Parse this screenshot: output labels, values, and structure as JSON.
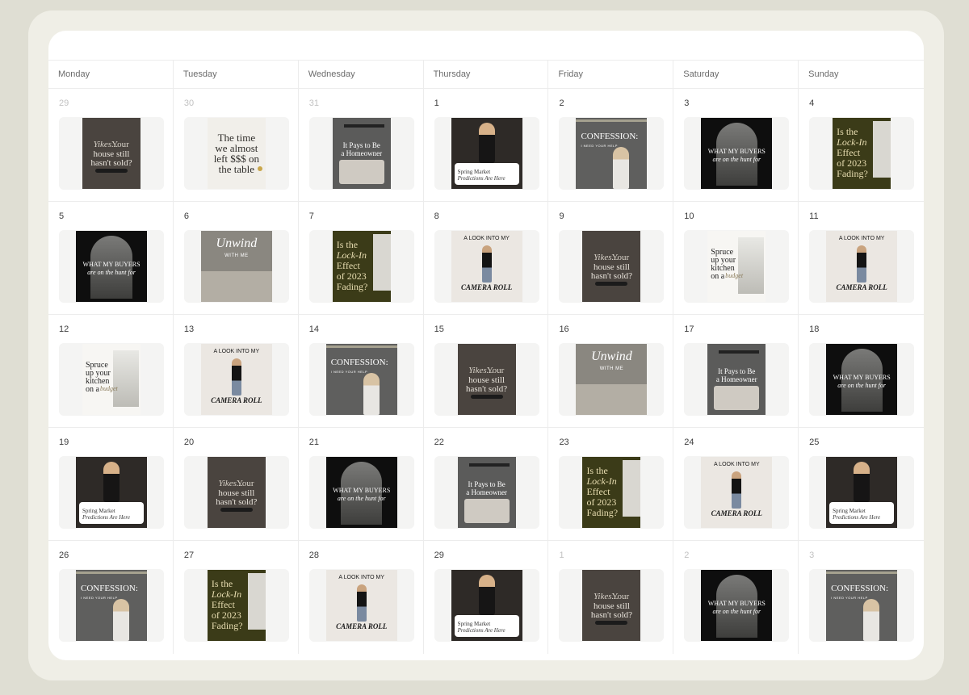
{
  "days": [
    "Monday",
    "Tuesday",
    "Wednesday",
    "Thursday",
    "Friday",
    "Saturday",
    "Sunday"
  ],
  "weeks": [
    [
      {
        "n": "29",
        "muted": true,
        "post": "yikes"
      },
      {
        "n": "30",
        "muted": true,
        "post": "time"
      },
      {
        "n": "31",
        "muted": true,
        "post": "pays"
      },
      {
        "n": "1",
        "muted": false,
        "post": "spring"
      },
      {
        "n": "2",
        "muted": false,
        "post": "confession"
      },
      {
        "n": "3",
        "muted": false,
        "post": "buyers"
      },
      {
        "n": "4",
        "muted": false,
        "post": "lockin"
      }
    ],
    [
      {
        "n": "5",
        "muted": false,
        "post": "buyers"
      },
      {
        "n": "6",
        "muted": false,
        "post": "unwind"
      },
      {
        "n": "7",
        "muted": false,
        "post": "lockin"
      },
      {
        "n": "8",
        "muted": false,
        "post": "camera"
      },
      {
        "n": "9",
        "muted": false,
        "post": "yikes"
      },
      {
        "n": "10",
        "muted": false,
        "post": "spruce"
      },
      {
        "n": "11",
        "muted": false,
        "post": "camera"
      }
    ],
    [
      {
        "n": "12",
        "muted": false,
        "post": "spruce"
      },
      {
        "n": "13",
        "muted": false,
        "post": "camera"
      },
      {
        "n": "14",
        "muted": false,
        "post": "confession"
      },
      {
        "n": "15",
        "muted": false,
        "post": "yikes"
      },
      {
        "n": "16",
        "muted": false,
        "post": "unwind"
      },
      {
        "n": "17",
        "muted": false,
        "post": "pays"
      },
      {
        "n": "18",
        "muted": false,
        "post": "buyers"
      }
    ],
    [
      {
        "n": "19",
        "muted": false,
        "post": "spring"
      },
      {
        "n": "20",
        "muted": false,
        "post": "yikes"
      },
      {
        "n": "21",
        "muted": false,
        "post": "buyers"
      },
      {
        "n": "22",
        "muted": false,
        "post": "pays"
      },
      {
        "n": "23",
        "muted": false,
        "post": "lockin"
      },
      {
        "n": "24",
        "muted": false,
        "post": "camera"
      },
      {
        "n": "25",
        "muted": false,
        "post": "spring"
      }
    ],
    [
      {
        "n": "26",
        "muted": false,
        "post": "confession"
      },
      {
        "n": "27",
        "muted": false,
        "post": "lockin"
      },
      {
        "n": "28",
        "muted": false,
        "post": "camera"
      },
      {
        "n": "29",
        "muted": false,
        "post": "spring"
      },
      {
        "n": "1",
        "muted": true,
        "post": "yikes"
      },
      {
        "n": "2",
        "muted": true,
        "post": "buyers"
      },
      {
        "n": "3",
        "muted": true,
        "post": "confession"
      }
    ]
  ],
  "posts": {
    "yikes": {
      "l1": "Yikes...",
      "l2": "Your",
      "l3": "house still",
      "l4": "hasn't sold?",
      "bg": "#4a443f"
    },
    "time": {
      "l1": "The time",
      "l2": "we almost",
      "l3": "left $$$ on",
      "l4": "the table",
      "bg": "#f1efea"
    },
    "pays": {
      "l1": "It Pays to Be",
      "l2": "a Homeowner",
      "bg": "#5b5b5a"
    },
    "spring": {
      "l1": "Spring Market",
      "l2": "Predictions Are Here",
      "bg": "#2e2a27"
    },
    "confession": {
      "l1": "CONFESSION:",
      "l2": "I NEED YOUR HELP",
      "bg": "#5f5f5e"
    },
    "buyers": {
      "l1": "WHAT MY BUYERS",
      "l2": "are on the hunt for",
      "bg": "#0e0e0e"
    },
    "lockin": {
      "l1": "Is the",
      "l2": "Lock-In",
      "l3": "Effect",
      "l4": "of 2023",
      "l5": "Fading?",
      "bg": "#3b3b18"
    },
    "unwind": {
      "l1": "Unwind",
      "l2": "WITH ME",
      "bg": "#8a8780"
    },
    "camera": {
      "l1": "A LOOK INTO MY",
      "l2": "CAMERA ROLL",
      "bg": "#ebe7e2"
    },
    "spruce": {
      "l1": "Spruce",
      "l2": "up your",
      "l3": "kitchen",
      "l4": "on a",
      "l5": "budget",
      "bg": "#f7f6f3"
    }
  },
  "colors": {
    "olive_text": "#e7dcb0",
    "accent_gold": "#c9a64a"
  }
}
